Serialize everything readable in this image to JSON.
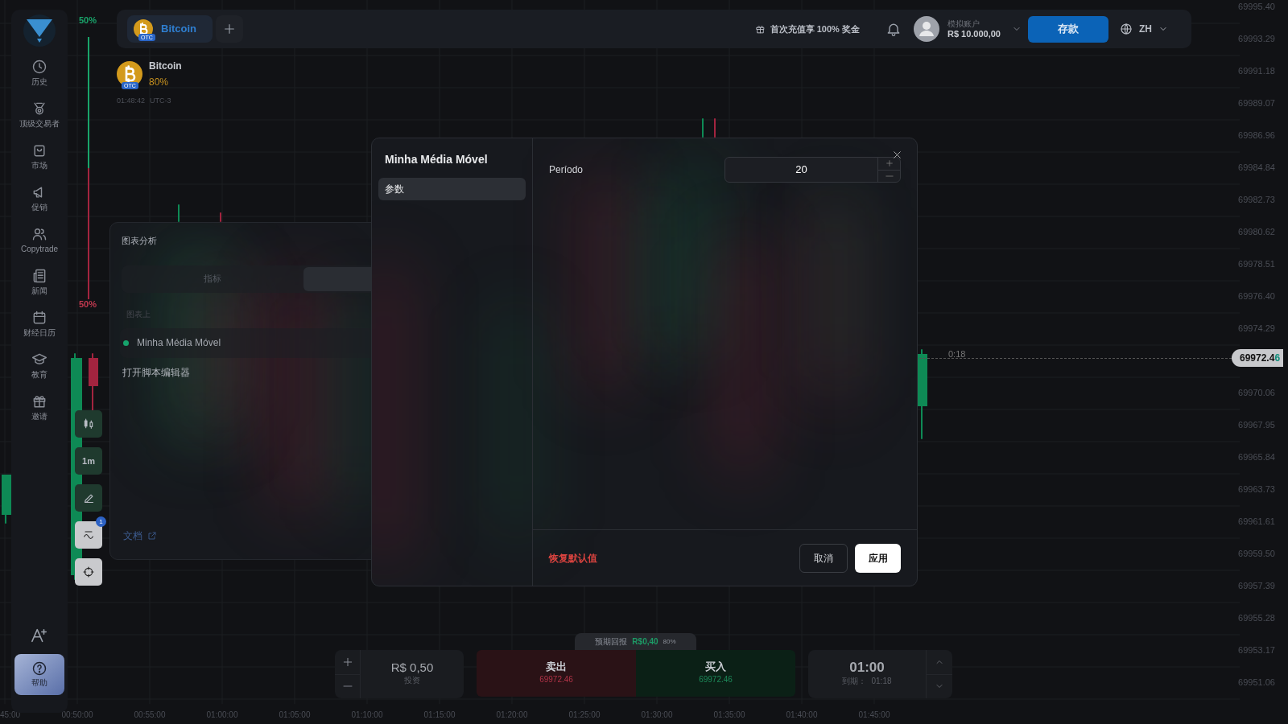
{
  "sidebar": {
    "items": [
      {
        "label": "历史"
      },
      {
        "label": "顶级交易者"
      },
      {
        "label": "市场"
      },
      {
        "label": "促销"
      },
      {
        "label": "Copytrade"
      },
      {
        "label": "新闻"
      },
      {
        "label": "财经日历"
      },
      {
        "label": "教育"
      },
      {
        "label": "邀请"
      }
    ],
    "help": "帮助"
  },
  "sentiment": {
    "up": "50%",
    "down": "50%",
    "level": 0.5
  },
  "top_bar": {
    "tabs": [
      {
        "label": "Bitcoin",
        "badge": "OTC",
        "selected": true
      }
    ],
    "promo": "首次充值享 100% 奖金",
    "account": {
      "label": "模拟账户",
      "balance": "R$ 10.000,00"
    },
    "deposit": "存款",
    "language": "ZH"
  },
  "asset": {
    "name": "Bitcoin",
    "badge": "OTC",
    "payout": "80%",
    "time": "01:48:42",
    "timezone": "UTC-3"
  },
  "price_axis": [
    "69995.40",
    "69993.29",
    "69991.18",
    "69989.07",
    "69986.96",
    "69984.84",
    "69982.73",
    "69980.62",
    "69978.51",
    "69976.40",
    "69974.29",
    "69970.06",
    "69967.95",
    "69965.84",
    "69963.73",
    "69961.61",
    "69959.50",
    "69957.39",
    "69955.28",
    "69953.17",
    "69951.06"
  ],
  "current_price": {
    "main": "69972.4",
    "last_digit": "6",
    "timer": "0:18"
  },
  "chart_tools": [
    {
      "kind": "candles"
    },
    {
      "kind": "text",
      "label": "1m"
    },
    {
      "kind": "pencil"
    },
    {
      "kind": "indicators",
      "badge": "1"
    },
    {
      "kind": "crosshair"
    }
  ],
  "analysis_panel": {
    "title": "图表分析",
    "tabs": [
      {
        "label": "指标",
        "selected": false
      }
    ],
    "section": "图表上",
    "items": [
      {
        "label": "Minha Média Móvel",
        "color": "#16a36c"
      }
    ],
    "script_editor": "打开脚本编辑器",
    "docs": "文档"
  },
  "modal": {
    "title": "Minha Média Móvel",
    "tabs": [
      {
        "label": "参数",
        "selected": true
      }
    ],
    "fields": [
      {
        "label": "Período",
        "value": "20"
      }
    ],
    "reset": "恢复默认值",
    "cancel": "取消",
    "apply": "应用"
  },
  "trade": {
    "amount": "R$ 0,50",
    "amount_label": "投资",
    "payout_label": "预期回报",
    "payout_value": "R$0,40",
    "payout_percent": "80%",
    "sell": {
      "label": "卖出",
      "price": "69972.46"
    },
    "buy": {
      "label": "买入",
      "price": "69972.46"
    },
    "duration": "01:00",
    "expiry_label": "到期：",
    "expiry": "01:18"
  },
  "time_axis": [
    "45:00",
    "00:50:00",
    "00:55:00",
    "01:00:00",
    "01:05:00",
    "01:10:00",
    "01:15:00",
    "01:20:00",
    "01:25:00",
    "01:30:00",
    "01:35:00",
    "01:40:00",
    "01:45:00"
  ]
}
